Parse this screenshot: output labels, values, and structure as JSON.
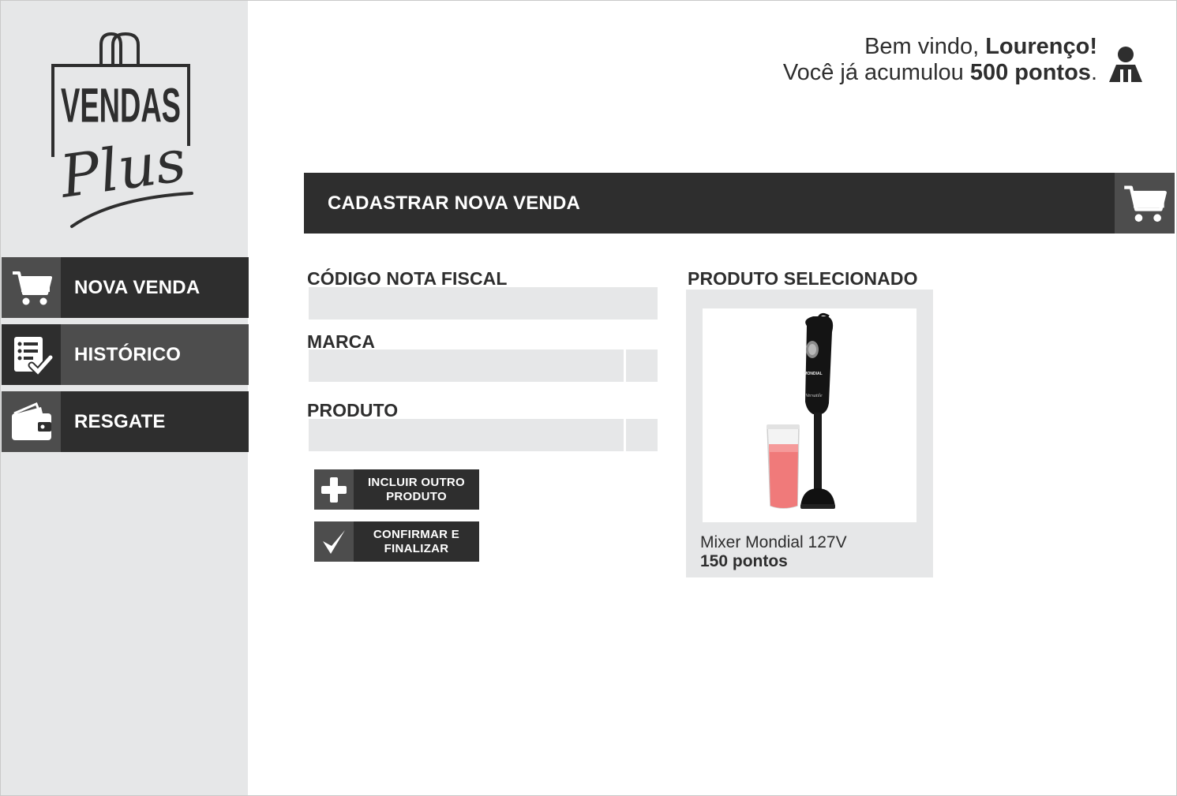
{
  "brand": {
    "line1": "VENDAS",
    "line2": "Plus"
  },
  "welcome": {
    "greeting": "Bem vindo, ",
    "user_name": "Lourenço!",
    "points_prefix": "Você já acumulou ",
    "points_value": "500 pontos",
    "points_suffix": "."
  },
  "sidebar": {
    "items": [
      {
        "label": "NOVA VENDA",
        "icon": "cart-icon"
      },
      {
        "label": "HISTÓRICO",
        "icon": "checklist-icon"
      },
      {
        "label": "RESGATE",
        "icon": "wallet-icon"
      }
    ]
  },
  "page": {
    "title": "CADASTRAR NOVA VENDA"
  },
  "form": {
    "invoice_label": "CÓDIGO NOTA FISCAL",
    "invoice_value": "",
    "brand_label": "MARCA",
    "brand_value": "",
    "product_label": "PRODUTO",
    "product_value": "",
    "add_product_line1": "INCLUIR OUTRO",
    "add_product_line2": "PRODUTO",
    "confirm_line1": "CONFIRMAR E",
    "confirm_line2": "FINALIZAR"
  },
  "selected_product": {
    "section_label": "PRODUTO SELECIONADO",
    "name": "Mixer Mondial 127V",
    "points": "150 pontos",
    "brand_print": "MONDIAL",
    "model_print": "Versatile"
  },
  "colors": {
    "dark": "#2e2e2e",
    "medium": "#4d4d4d",
    "light": "#e6e7e8"
  }
}
